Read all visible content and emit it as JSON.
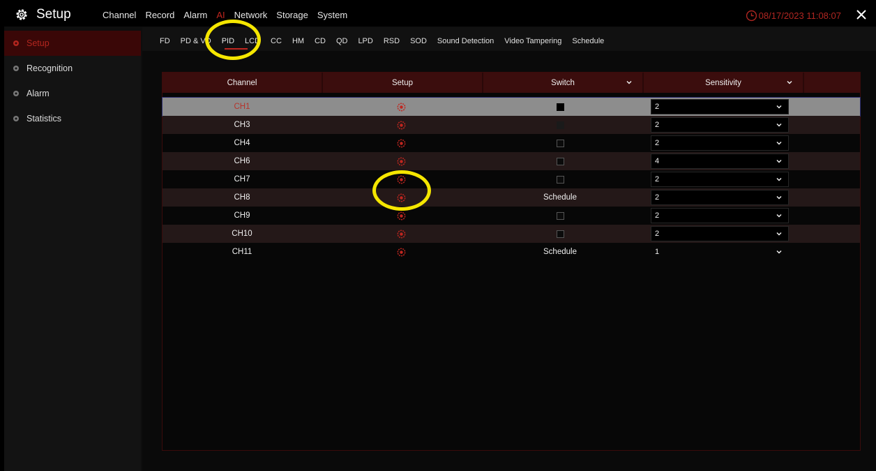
{
  "app": {
    "title": "Setup",
    "datetime": "08/17/2023 11:08:07"
  },
  "main_nav": [
    "Channel",
    "Record",
    "Alarm",
    "AI",
    "Network",
    "Storage",
    "System"
  ],
  "main_nav_active": "AI",
  "sidebar": {
    "items": [
      {
        "label": "Setup",
        "active": true
      },
      {
        "label": "Recognition",
        "active": false
      },
      {
        "label": "Alarm",
        "active": false
      },
      {
        "label": "Statistics",
        "active": false
      }
    ]
  },
  "sub_tabs": [
    "FD",
    "PD & VD",
    "PID",
    "LCD",
    "CC",
    "HM",
    "CD",
    "QD",
    "LPD",
    "RSD",
    "SOD",
    "Sound Detection",
    "Video Tampering",
    "Schedule"
  ],
  "sub_tab_active": "PID",
  "table": {
    "headers": {
      "channel": "Channel",
      "setup": "Setup",
      "switch": "Switch",
      "sensitivity": "Sensitivity"
    },
    "rows": [
      {
        "channel": "CH1",
        "switch": "checked",
        "sensitivity": "2",
        "selected": true
      },
      {
        "channel": "CH3",
        "switch": "disabled",
        "sensitivity": "2"
      },
      {
        "channel": "CH4",
        "switch": "unchecked",
        "sensitivity": "2"
      },
      {
        "channel": "CH6",
        "switch": "unchecked",
        "sensitivity": "4"
      },
      {
        "channel": "CH7",
        "switch": "unchecked",
        "sensitivity": "2"
      },
      {
        "channel": "CH8",
        "switch": "Schedule",
        "sensitivity": "2"
      },
      {
        "channel": "CH9",
        "switch": "unchecked",
        "sensitivity": "2"
      },
      {
        "channel": "CH10",
        "switch": "unchecked",
        "sensitivity": "2"
      },
      {
        "channel": "CH11",
        "switch": "Schedule",
        "sensitivity": "1"
      }
    ]
  },
  "colors": {
    "accent": "#c0261f",
    "highlight_ring": "#f5e600"
  },
  "icons": {
    "brand": "gear-icon",
    "clock": "clock-icon",
    "close": "close-icon",
    "setup": "target-icon",
    "dropdown": "chevron-down-icon"
  }
}
